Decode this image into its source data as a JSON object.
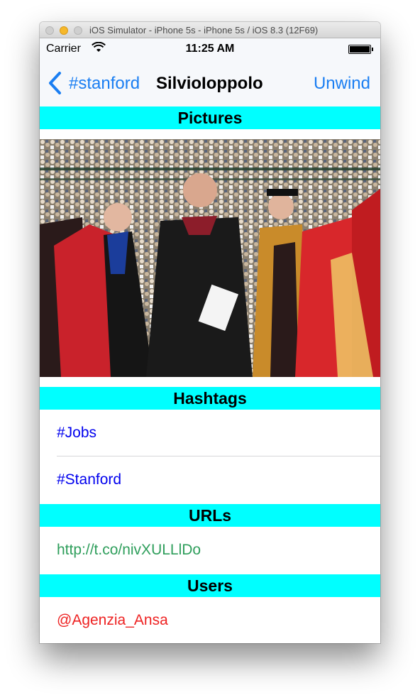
{
  "window": {
    "title": "iOS Simulator - iPhone 5s - iPhone 5s / iOS 8.3 (12F69)"
  },
  "status_bar": {
    "carrier": "Carrier",
    "time": "11:25 AM"
  },
  "nav": {
    "back_label": "#stanford",
    "title": "SilvioIoppolo",
    "right_button": "Unwind"
  },
  "sections": {
    "pictures": "Pictures",
    "hashtags": "Hashtags",
    "urls": "URLs",
    "users": "Users"
  },
  "hashtags": [
    "#Jobs",
    "#Stanford"
  ],
  "urls": [
    "http://t.co/nivXULLlDo"
  ],
  "users": [
    "@Agenzia_Ansa"
  ],
  "colors": {
    "section_header_bg": "#00ffff",
    "tint": "#1a7ef2",
    "hashtag_text": "#0000ee",
    "url_text": "#2e9e5b",
    "user_text": "#ee2222"
  },
  "icons": [
    "close-dot",
    "minimize-dot",
    "zoom-dot",
    "wifi-icon",
    "battery-icon",
    "back-chevron-icon"
  ]
}
